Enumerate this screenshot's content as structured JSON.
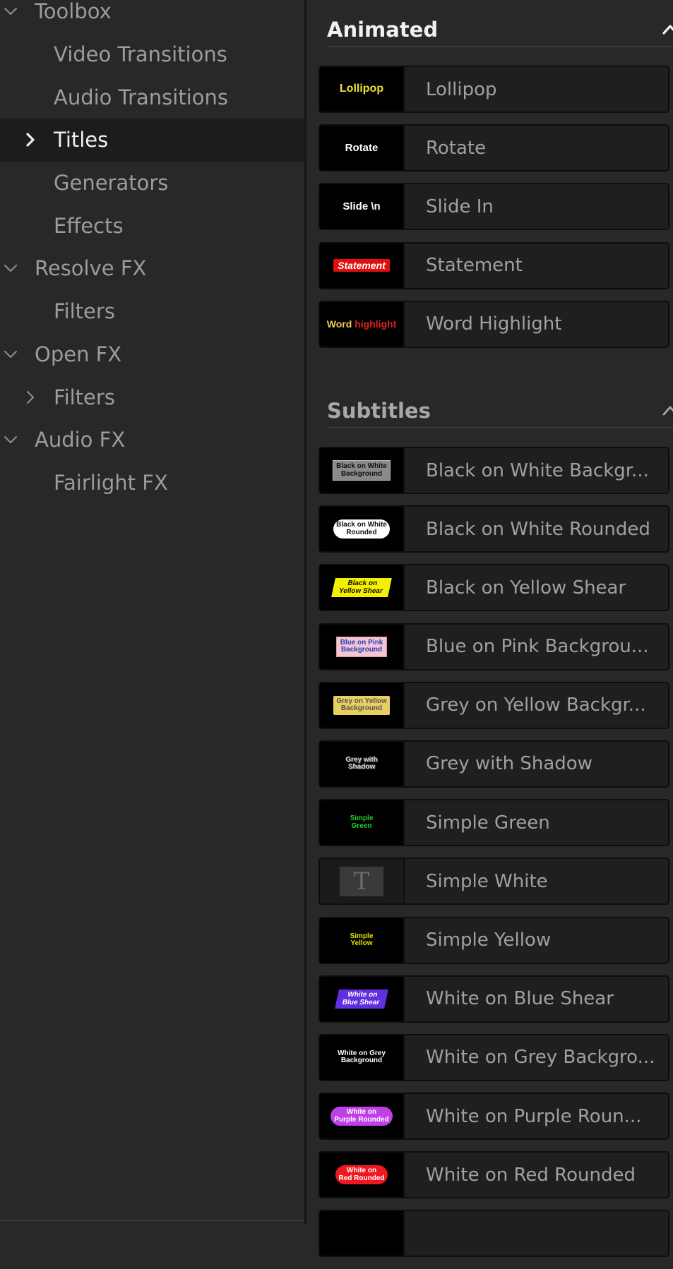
{
  "sidebar": {
    "items": [
      {
        "label": "Toolbox",
        "level": 0,
        "chevron": "down",
        "selected": false
      },
      {
        "label": "Video Transitions",
        "level": 1,
        "chevron": "",
        "selected": false
      },
      {
        "label": "Audio Transitions",
        "level": 1,
        "chevron": "",
        "selected": false
      },
      {
        "label": "Titles",
        "level": 1,
        "chevron": "right",
        "selected": true
      },
      {
        "label": "Generators",
        "level": 1,
        "chevron": "",
        "selected": false
      },
      {
        "label": "Effects",
        "level": 1,
        "chevron": "",
        "selected": false
      },
      {
        "label": "Resolve FX",
        "level": 0,
        "chevron": "down",
        "selected": false
      },
      {
        "label": "Filters",
        "level": 1,
        "chevron": "",
        "selected": false
      },
      {
        "label": "Open FX",
        "level": 0,
        "chevron": "down",
        "selected": false
      },
      {
        "label": "Filters",
        "level": 1,
        "chevron": "right",
        "selected": false
      },
      {
        "label": "Audio FX",
        "level": 0,
        "chevron": "down",
        "selected": false
      },
      {
        "label": "Fairlight FX",
        "level": 1,
        "chevron": "",
        "selected": false
      }
    ]
  },
  "animated": {
    "title": "Animated",
    "items": [
      {
        "name": "Lollipop",
        "thumb": {
          "style": "lollipop",
          "text": "Lollipop"
        }
      },
      {
        "name": "Rotate",
        "thumb": {
          "style": "rotate",
          "text": "Rotate"
        }
      },
      {
        "name": "Slide In",
        "thumb": {
          "style": "slidein",
          "text": "Slide \\n"
        }
      },
      {
        "name": "Statement",
        "thumb": {
          "style": "statement",
          "text": "Statement"
        }
      },
      {
        "name": "Word Highlight",
        "thumb": {
          "style": "word",
          "text": "Word",
          "text2": "highlight"
        }
      }
    ]
  },
  "subtitles": {
    "title": "Subtitles",
    "items": [
      {
        "name": "Black on White Backgr...",
        "thumb": {
          "style": "bow-bg",
          "text": "Black on White",
          "text2": "Background"
        }
      },
      {
        "name": "Black on White Rounded",
        "thumb": {
          "style": "bow-round",
          "text": "Black on White",
          "text2": "Rounded"
        }
      },
      {
        "name": "Black on Yellow Shear",
        "thumb": {
          "style": "boy-shear",
          "text": "Black on",
          "text2": "Yellow Shear"
        }
      },
      {
        "name": "Blue on Pink Backgrou...",
        "thumb": {
          "style": "bop",
          "text": "Blue on Pink",
          "text2": "Background"
        }
      },
      {
        "name": "Grey on Yellow Backgr...",
        "thumb": {
          "style": "goy",
          "text": "Grey on Yellow",
          "text2": "Background"
        }
      },
      {
        "name": "Grey with Shadow",
        "thumb": {
          "style": "gws",
          "text": "Grey with",
          "text2": "Shadow"
        }
      },
      {
        "name": "Simple Green",
        "thumb": {
          "style": "sg",
          "text": "Simple",
          "text2": "Green"
        }
      },
      {
        "name": "Simple White",
        "thumb": {
          "style": "t",
          "text": "T"
        }
      },
      {
        "name": "Simple Yellow",
        "thumb": {
          "style": "sy",
          "text": "Simple",
          "text2": "Yellow"
        }
      },
      {
        "name": "White on Blue Shear",
        "thumb": {
          "style": "wob",
          "text": "White on",
          "text2": "Blue Shear"
        }
      },
      {
        "name": "White on Grey Backgro...",
        "thumb": {
          "style": "wog",
          "text": "White on Grey",
          "text2": "Background"
        }
      },
      {
        "name": "White on Purple Roun...",
        "thumb": {
          "style": "wop",
          "text": "White on",
          "text2": "Purple Rounded"
        }
      },
      {
        "name": "White on Red Rounded",
        "thumb": {
          "style": "wor",
          "text": "White on",
          "text2": "Red Rounded"
        }
      },
      {
        "name": "",
        "thumb": {
          "style": "t-partial",
          "text": ""
        }
      }
    ]
  },
  "colors": {
    "background": "#282828",
    "selected_row": "#1c1c1c",
    "tile_bg": "#1f1f1f",
    "text_dim": "#9c9c9c",
    "text_bright": "#f0f0f0"
  },
  "icons": {
    "expand": "chevron-down-icon",
    "collapsed": "chevron-right-icon",
    "section_collapse": "chevron-up-icon"
  }
}
